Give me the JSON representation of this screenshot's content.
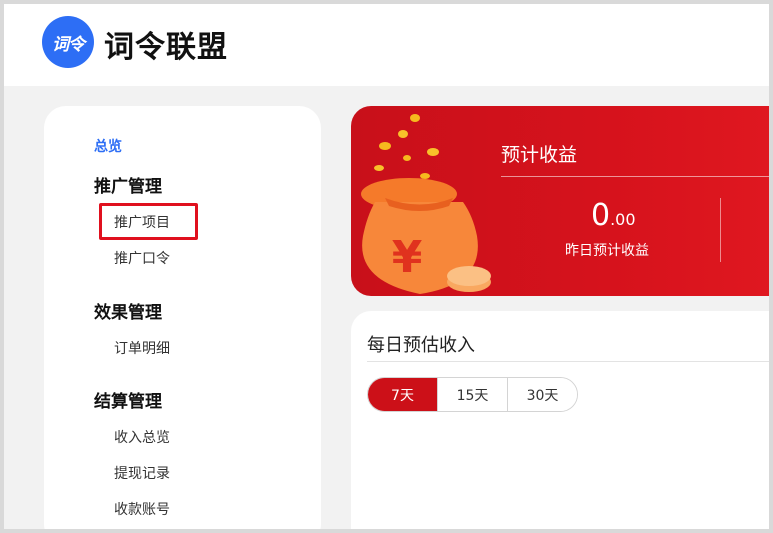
{
  "header": {
    "logo_text": "词令",
    "brand_name": "词令联盟"
  },
  "sidebar": {
    "overview": "总览",
    "groups": [
      {
        "title": "推广管理",
        "items": [
          "推广项目",
          "推广口令"
        ]
      },
      {
        "title": "效果管理",
        "items": [
          "订单明细"
        ]
      },
      {
        "title": "结算管理",
        "items": [
          "收入总览",
          "提现记录",
          "收款账号"
        ]
      }
    ],
    "selected_item": "推广项目"
  },
  "banner": {
    "title": "预计收益",
    "amount_integer": "0",
    "amount_decimal": ".00",
    "amount_label": "昨日预计收益",
    "currency_symbol": "¥"
  },
  "daily_income": {
    "title": "每日预估收入",
    "tabs": [
      "7天",
      "15天",
      "30天"
    ],
    "active_tab": "7天"
  },
  "colors": {
    "brand_blue": "#2d6ef5",
    "banner_red": "#cc1018",
    "highlight_red": "#e0101e"
  }
}
